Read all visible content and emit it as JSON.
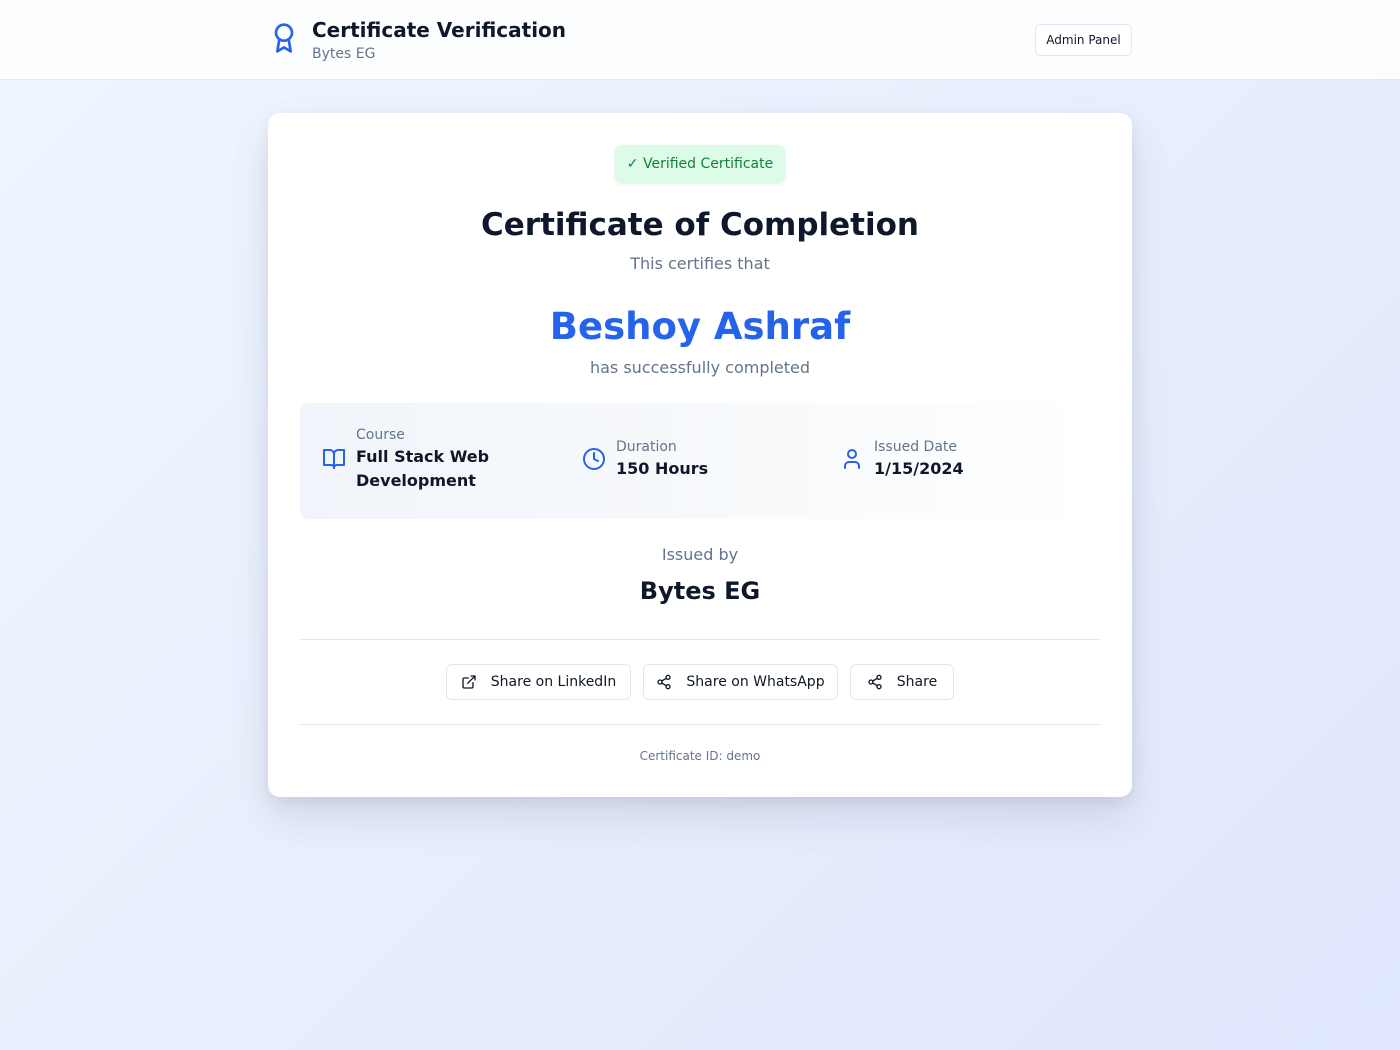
{
  "header": {
    "title": "Certificate Verification",
    "subtitle": "Bytes EG",
    "admin_button": "Admin Panel",
    "logo_icon": "award-icon"
  },
  "certificate": {
    "badge": "✓ Verified Certificate",
    "title": "Certificate of Completion",
    "certifies": "This certifies that",
    "recipient": "Beshoy Ashraf",
    "completed": "has successfully completed",
    "details": {
      "course_label": "Course",
      "course_value": "Full Stack Web Development",
      "duration_label": "Duration",
      "duration_value": "150 Hours",
      "date_label": "Issued Date",
      "date_value": "1/15/2024"
    },
    "issued_by_label": "Issued by",
    "issuer": "Bytes EG",
    "certificate_id": "Certificate ID: demo"
  },
  "share": {
    "linkedin": "Share on LinkedIn",
    "whatsapp": "Share on WhatsApp",
    "generic": "Share"
  },
  "colors": {
    "accent": "#2563eb",
    "verified_bg": "#dcfce7",
    "verified_text": "#15803d",
    "muted_text": "#64748b"
  }
}
